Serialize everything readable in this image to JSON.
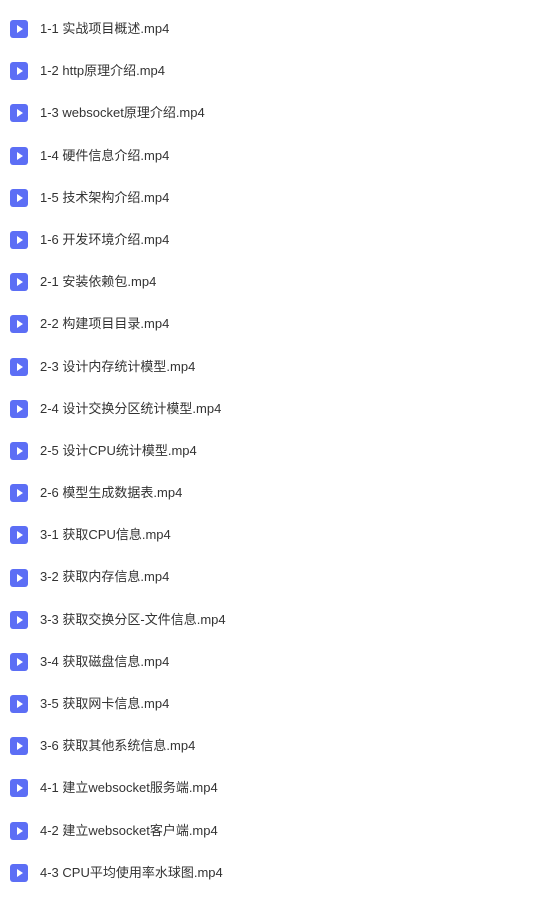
{
  "files": [
    {
      "name": "1-1 实战项目概述.mp4"
    },
    {
      "name": "1-2 http原理介绍.mp4"
    },
    {
      "name": "1-3 websocket原理介绍.mp4"
    },
    {
      "name": "1-4 硬件信息介绍.mp4"
    },
    {
      "name": "1-5 技术架构介绍.mp4"
    },
    {
      "name": "1-6 开发环境介绍.mp4"
    },
    {
      "name": "2-1 安装依赖包.mp4"
    },
    {
      "name": "2-2 构建项目目录.mp4"
    },
    {
      "name": "2-3 设计内存统计模型.mp4"
    },
    {
      "name": "2-4 设计交换分区统计模型.mp4"
    },
    {
      "name": "2-5 设计CPU统计模型.mp4"
    },
    {
      "name": "2-6 模型生成数据表.mp4"
    },
    {
      "name": "3-1 获取CPU信息.mp4"
    },
    {
      "name": "3-2 获取内存信息.mp4"
    },
    {
      "name": "3-3 获取交换分区-文件信息.mp4"
    },
    {
      "name": "3-4 获取磁盘信息.mp4"
    },
    {
      "name": "3-5 获取网卡信息.mp4"
    },
    {
      "name": "3-6 获取其他系统信息.mp4"
    },
    {
      "name": "4-1 建立websocket服务端.mp4"
    },
    {
      "name": "4-2 建立websocket客户端.mp4"
    },
    {
      "name": "4-3 CPU平均使用率水球图.mp4"
    }
  ]
}
